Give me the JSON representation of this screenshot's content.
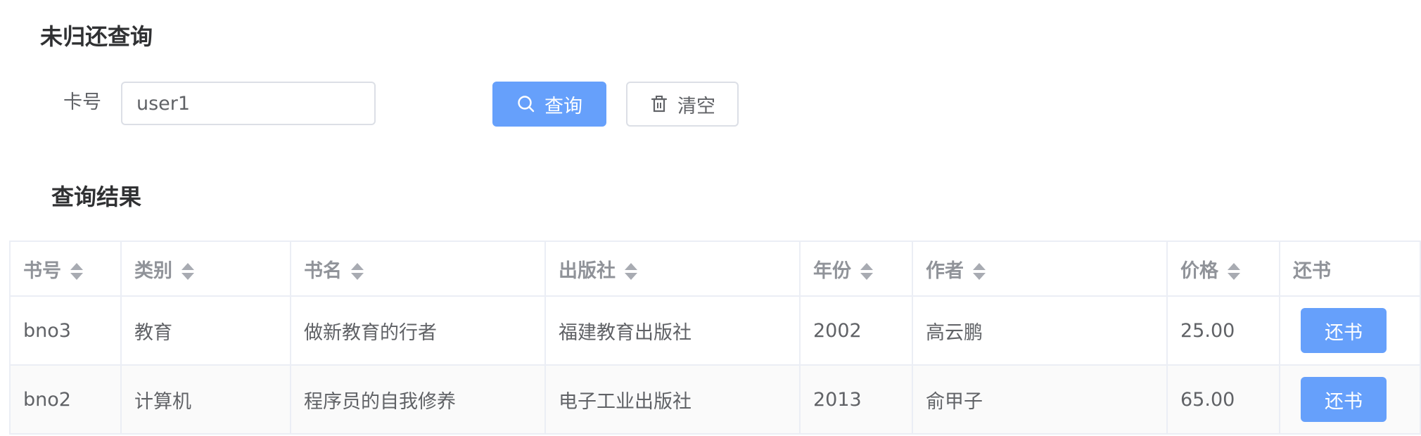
{
  "header": {
    "unreturned_title": "未归还查询",
    "results_title": "查询结果"
  },
  "search": {
    "card_label": "卡号",
    "card_value": "user1",
    "query_label": "查询",
    "clear_label": "清空",
    "query_icon": "search-icon",
    "clear_icon": "trash-icon"
  },
  "colors": {
    "primary": "#66a0fb",
    "title": "#303133",
    "text": "#606266",
    "header_text": "#909399",
    "border": "#ebeef5"
  },
  "table": {
    "columns": [
      "书号",
      "类别",
      "书名",
      "出版社",
      "年份",
      "作者",
      "价格",
      "还书"
    ],
    "sortable": [
      true,
      true,
      true,
      true,
      true,
      true,
      true,
      false
    ],
    "rows": [
      {
        "bno": "bno3",
        "category": "教育",
        "title": "做新教育的行者",
        "press": "福建教育出版社",
        "year": "2002",
        "author": "高云鹏",
        "price": "25.00",
        "action": "还书"
      },
      {
        "bno": "bno2",
        "category": "计算机",
        "title": "程序员的自我修养",
        "press": "电子工业出版社",
        "year": "2013",
        "author": "俞甲子",
        "price": "65.00",
        "action": "还书"
      }
    ]
  }
}
